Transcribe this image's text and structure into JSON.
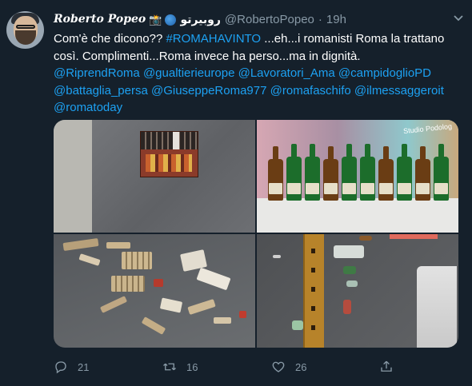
{
  "tweet": {
    "display_name": "Roberto Popeo",
    "display_name_arabic": "روبيرتو",
    "handle": "@RobertoPopeo",
    "separator": "·",
    "time": "19h",
    "text": {
      "line1_plain_a": "Com'è che dicono?? ",
      "line1_hashtag": "#ROMAHAVINTO",
      "line1_plain_b": " ...eh...i romanisti Roma la trattano",
      "line2": "così. Complimenti...Roma invece ha perso...ma in dignità.",
      "mentions_line1": [
        "@RiprendRoma",
        "@gualtierieurope",
        "@Lavoratori_Ama",
        "@campidoglioPD"
      ],
      "mentions_line2": [
        "@battaglia_persa",
        "@GiuseppeRoma977",
        "@romafaschifo",
        "@ilmessaggeroit"
      ],
      "mentions_line3": [
        "@romatoday"
      ]
    },
    "media": [
      {
        "name": "fireworks-box-on-asphalt"
      },
      {
        "name": "bottles-on-kiosk-counter",
        "sign": "Studio Podolog"
      },
      {
        "name": "firework-debris-on-street"
      },
      {
        "name": "bottles-by-wooden-curb"
      }
    ],
    "actions": {
      "reply_count": "21",
      "retweet_count": "16",
      "like_count": "26"
    },
    "icons": {
      "camera_emoji": "camera-icon",
      "globe_emoji": "globe-icon",
      "more": "chevron-down-icon",
      "reply": "reply-icon",
      "retweet": "retweet-icon",
      "like": "heart-icon",
      "share": "share-icon"
    }
  },
  "colors": {
    "background": "#15202b",
    "link": "#1da1f2",
    "muted": "#8899a6"
  }
}
